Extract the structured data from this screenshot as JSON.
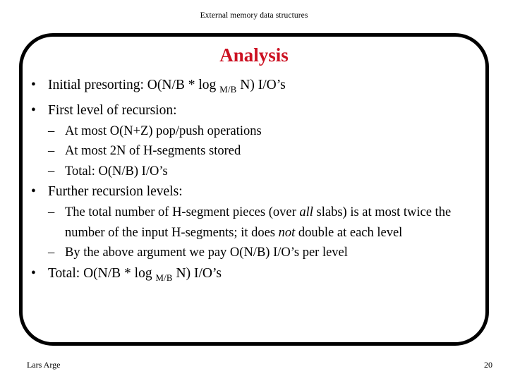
{
  "header": {
    "running_title": "External memory data structures"
  },
  "slide": {
    "title": "Analysis",
    "title_color": "#cc1122",
    "frame_border_color": "#000000"
  },
  "body": {
    "items": [
      {
        "level": 1,
        "bullet": "•",
        "text_before": "Initial presorting: O(N/B * log ",
        "subscript": "M/B",
        "text_after": " N) I/O’s"
      },
      {
        "level": 1,
        "bullet": "•",
        "text": "First level of recursion:"
      },
      {
        "level": 2,
        "bullet": "–",
        "text": "At most O(N+Z) pop/push operations"
      },
      {
        "level": 2,
        "bullet": "–",
        "text": "At most 2N of H-segments stored"
      },
      {
        "level": 2,
        "bullet": "–",
        "text": "Total: O(N/B) I/O’s"
      },
      {
        "level": 1,
        "bullet": "•",
        "text": "Further recursion levels:"
      },
      {
        "level": 2,
        "bullet": "–",
        "seg1": "The total number of H-segment pieces (over ",
        "italic1": "all",
        "seg2": " slabs) is at most twice the number of the input H-segments; it does ",
        "italic2": "not",
        "seg3": " double at each level"
      },
      {
        "level": 2,
        "bullet": "–",
        "text": "By the above argument we pay O(N/B) I/O’s per level"
      },
      {
        "level": 1,
        "bullet": "•",
        "text_before": "Total: O(N/B * log ",
        "subscript": "M/B",
        "text_after": " N) I/O’s"
      }
    ]
  },
  "footer": {
    "author": "Lars Arge",
    "page_number": "20"
  }
}
